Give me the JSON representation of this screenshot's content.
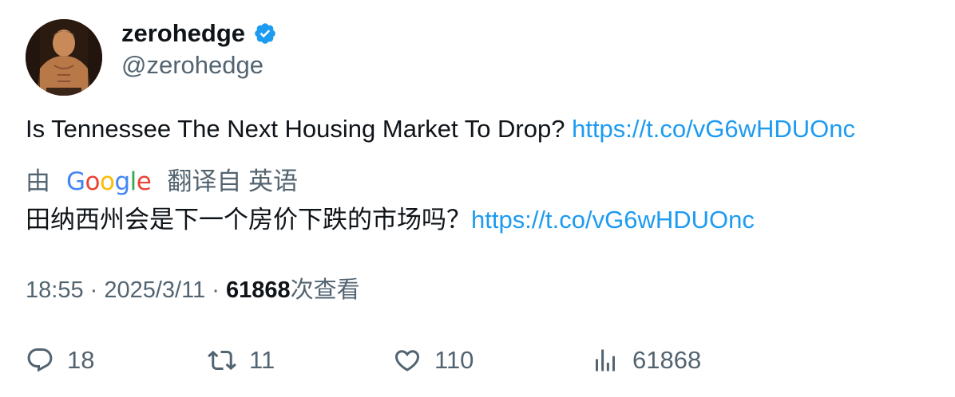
{
  "author": {
    "display_name": "zerohedge",
    "handle": "@zerohedge",
    "verified": true
  },
  "tweet": {
    "text": "Is Tennessee The Next Housing Market To Drop? ",
    "link": "https://t.co/vG6wHDUOnc"
  },
  "translation": {
    "prefix": "由",
    "provider": "Google",
    "suffix": "翻译自 英语",
    "text": "田纳西州会是下一个房价下跌的市场吗？",
    "link": "https://t.co/vG6wHDUOnc"
  },
  "meta": {
    "time": "18:55",
    "separator": " · ",
    "date": "2025/3/11",
    "views_count": "61868",
    "views_label": "次查看"
  },
  "actions": {
    "replies": "18",
    "retweets": "11",
    "likes": "110",
    "views": "61868"
  },
  "colors": {
    "link": "#1d9bf0",
    "secondary_text": "#536471",
    "primary_text": "#0f1419",
    "verified": "#1d9bf0"
  },
  "icons": [
    "verified-badge-icon",
    "reply-icon",
    "retweet-icon",
    "like-icon",
    "views-icon"
  ]
}
